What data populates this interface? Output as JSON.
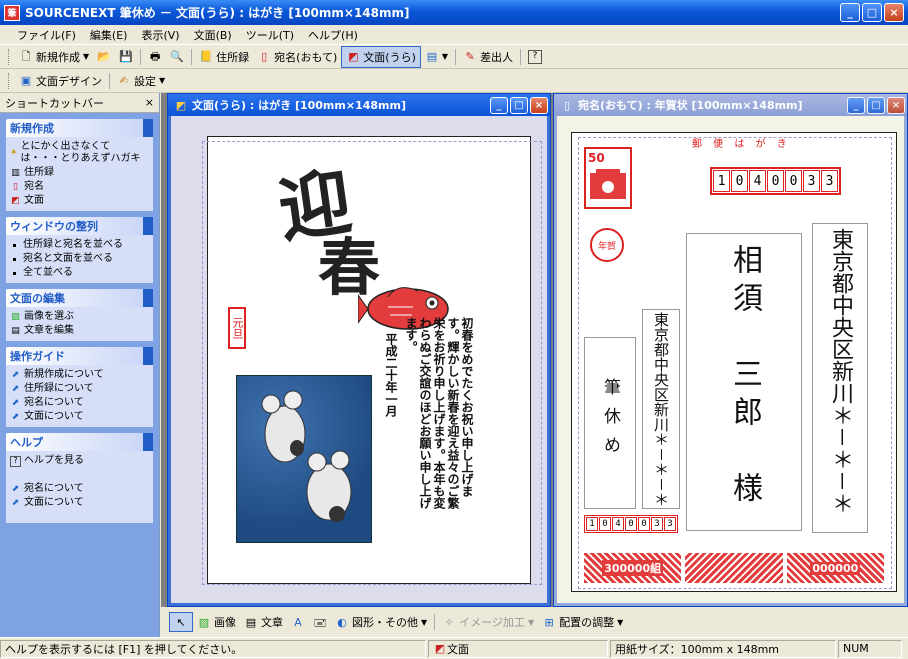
{
  "window": {
    "title": "SOURCENEXT 筆休め － 文面(うら) : はがき [100mm×148mm]",
    "minimize": "_",
    "maximize": "□",
    "close": "×"
  },
  "menu": [
    "ファイル(F)",
    "編集(E)",
    "表示(V)",
    "文面(B)",
    "ツール(T)",
    "ヘルプ(H)"
  ],
  "toolbar1": {
    "new": "新規作成",
    "address_book": "住所録",
    "address_front": "宛名(おもて)",
    "text_back": "文面(うら)",
    "sender": "差出人",
    "help": "?"
  },
  "toolbar2": {
    "design": "文面デザイン",
    "settings": "設定"
  },
  "sidebar": {
    "header": "ショートカットバー",
    "close": "×",
    "sections": [
      {
        "title": "新規作成",
        "items": [
          "とにかく出さなくては・・・とりあえずハガキ",
          "住所録",
          "宛名",
          "文面"
        ]
      },
      {
        "title": "ウィンドウの整列",
        "items": [
          "住所録と宛名を並べる",
          "宛名と文面を並べる",
          "全て並べる"
        ]
      },
      {
        "title": "文面の編集",
        "items": [
          "画像を選ぶ",
          "文章を編集"
        ]
      },
      {
        "title": "操作ガイド",
        "items": [
          "新規作成について",
          "住所録について",
          "宛名について",
          "文面について"
        ]
      },
      {
        "title": "ヘルプ",
        "items": [
          "ヘルプを見る",
          "宛名について",
          "文面について"
        ]
      }
    ]
  },
  "child_back": {
    "title": "文面(うら) : はがき [100mm×148mm]",
    "kanji_1": "迎",
    "kanji_2": "春",
    "seal": "元旦",
    "message": "初春をめでたくお祝い申し上げます。輝かしい新春を迎え益々のご繁栄をお祈り申し上げます。本年も変わらぬご交誼のほどお願い申し上げます。",
    "date": "平成二十年一月"
  },
  "child_front": {
    "title": "宛名(おもて) : 年賀状 [100mm×148mm]",
    "header": "郵 便 は が き",
    "stamp_value": "50",
    "nenga": "年賀",
    "postal_code": [
      "1",
      "0",
      "4",
      "0",
      "0",
      "3",
      "3"
    ],
    "recipient_address": "東京都中央区新川＊－＊－＊",
    "recipient_name": "相須　三郎　様",
    "sender_address": "東京都中央区新川＊－＊－＊",
    "sender_name": "筆休め",
    "sender_postal": [
      "1",
      "0",
      "4",
      "0",
      "0",
      "3",
      "3"
    ],
    "lottery_1": "300000組",
    "lottery_2": "000000"
  },
  "bottombar": {
    "image": "画像",
    "text": "文章",
    "shapes": "図形・その他",
    "image_edit": "イメージ加工",
    "align": "配置の調整"
  },
  "status": {
    "help": "ヘルプを表示するには [F1] を押してください。",
    "mode": "文面",
    "paper": "用紙サイズ：100mm x 148mm",
    "num": "NUM"
  }
}
